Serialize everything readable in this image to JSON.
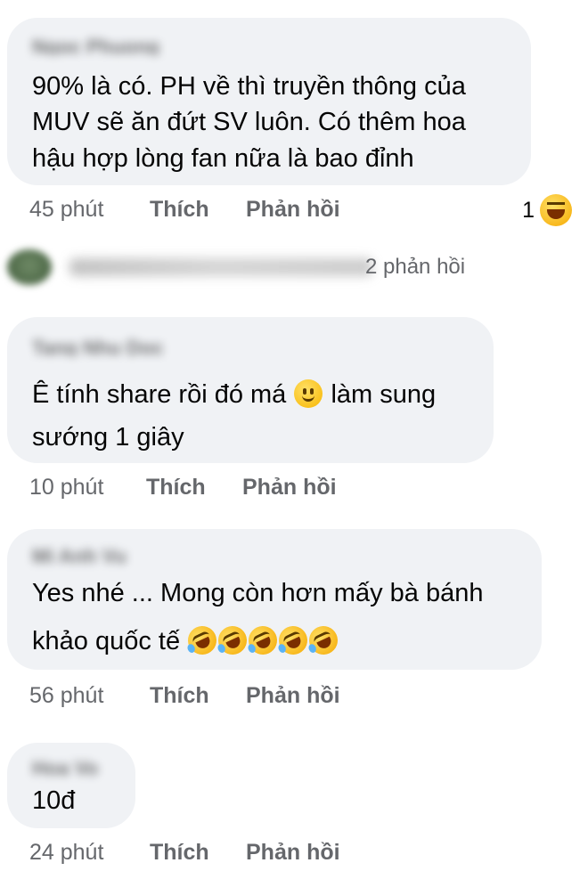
{
  "comments": [
    {
      "author": "Ngoc Phuong",
      "lines": [
        "90% là có. PH về thì truyền thông của",
        "MUV sẽ ăn đứt SV luôn. Có thêm hoa",
        "hậu hợp lòng fan nữa là bao đỉnh"
      ],
      "time": "45 phút",
      "like": "Thích",
      "reply": "Phản hồi",
      "reaction_count": "1",
      "reaction_icon": "laughing-emoji"
    },
    {
      "author": "Tang Nhu Doc",
      "lines": [
        "Ê tính share rồi đó má",
        "làm sung",
        "sướng 1 giây"
      ],
      "inline_emoji": "slightly-smiling-face",
      "time": "10 phút",
      "like": "Thích",
      "reply": "Phản hồi"
    },
    {
      "author": "Mi Anh Vu",
      "lines": [
        "Yes nhé ... Mong còn hơn mấy bà bánh",
        "khảo quốc tế"
      ],
      "inline_emoji": "rolling-on-floor-laughing",
      "inline_emoji_count": 5,
      "time": "56 phút",
      "like": "Thích",
      "reply": "Phản hồi"
    },
    {
      "author": "Hoa Vo",
      "lines": [
        "10đ"
      ],
      "time": "24 phút",
      "like": "Thích",
      "reply": "Phản hồi"
    }
  ],
  "collapsed_reply": {
    "replies_text": "2 phản hồi"
  },
  "colors": {
    "bubble": "#f0f2f5",
    "meta": "#65676b",
    "text": "#050505"
  }
}
